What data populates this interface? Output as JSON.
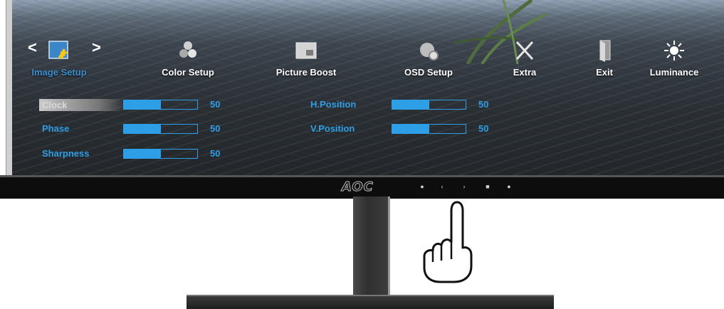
{
  "brand": "AOC",
  "menu": {
    "items": [
      {
        "label": "Image Setup",
        "icon": "image-setup-icon",
        "active": true
      },
      {
        "label": "Color Setup",
        "icon": "color-setup-icon",
        "active": false
      },
      {
        "label": "Picture Boost",
        "icon": "picture-boost-icon",
        "active": false
      },
      {
        "label": "OSD Setup",
        "icon": "osd-setup-icon",
        "active": false
      },
      {
        "label": "Extra",
        "icon": "extra-icon",
        "active": false
      },
      {
        "label": "Exit",
        "icon": "exit-icon",
        "active": false
      },
      {
        "label": "Luminance",
        "icon": "luminance-icon",
        "active": false
      }
    ],
    "prev_arrow": "<",
    "next_arrow": ">"
  },
  "settings": [
    {
      "label": "Clock",
      "value": "50",
      "level": 0.5,
      "selected": true
    },
    {
      "label": "Phase",
      "value": "50",
      "level": 0.5,
      "selected": false
    },
    {
      "label": "Sharpness",
      "value": "50",
      "level": 0.5,
      "selected": false
    },
    {
      "label": "H.Position",
      "value": "50",
      "level": 0.5,
      "selected": false
    },
    {
      "label": "V.Position",
      "value": "50",
      "level": 0.5,
      "selected": false
    }
  ],
  "bezel_buttons": [
    "power",
    "left",
    "right",
    "menu",
    "auto"
  ],
  "colors": {
    "accent": "#2e9ee6",
    "active_label": "#3b8fd0",
    "label": "#ffffff"
  }
}
